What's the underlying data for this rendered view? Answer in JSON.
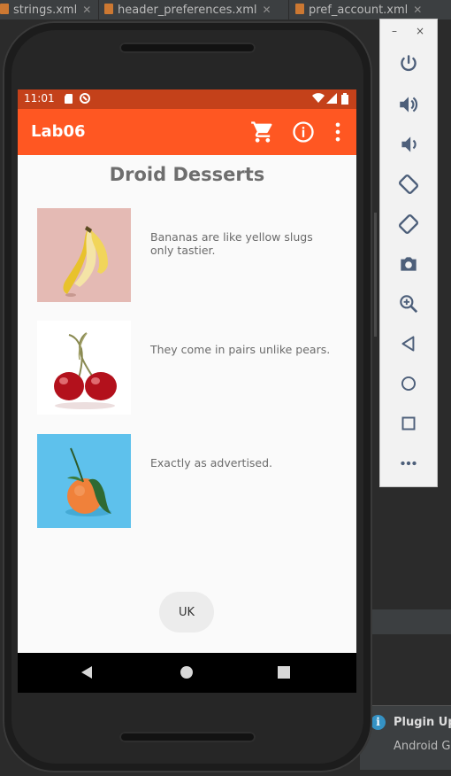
{
  "ide": {
    "tabs": [
      {
        "label": "strings.xml",
        "close": "✕"
      },
      {
        "label": "header_preferences.xml",
        "close": "✕"
      },
      {
        "label": "pref_account.xml",
        "close": "✕"
      }
    ],
    "notification": {
      "title": "Plugin Up",
      "subtitle": "Android G"
    }
  },
  "status_bar": {
    "time": "11:01"
  },
  "app_bar": {
    "title": "Lab06",
    "color": "#ff5722",
    "status_color": "#c4411a",
    "actions": [
      "cart-icon",
      "info-icon",
      "overflow-menu-icon"
    ]
  },
  "main": {
    "heading": "Droid Desserts",
    "items": [
      {
        "image": "banana-image",
        "text": "Bananas are like yellow slugs only tastier."
      },
      {
        "image": "cherries-image",
        "text": "They come in pairs unlike pears."
      },
      {
        "image": "mandarin-image",
        "text": "Exactly as advertised."
      }
    ],
    "button_label": "UK"
  },
  "emulator_toolbar": {
    "minimize": "–",
    "close": "×",
    "buttons": [
      "power-icon",
      "volume-up-icon",
      "volume-down-icon",
      "rotate-left-icon",
      "rotate-right-icon",
      "camera-icon",
      "zoom-icon",
      "back-icon",
      "home-icon",
      "overview-icon",
      "more-icon"
    ]
  }
}
